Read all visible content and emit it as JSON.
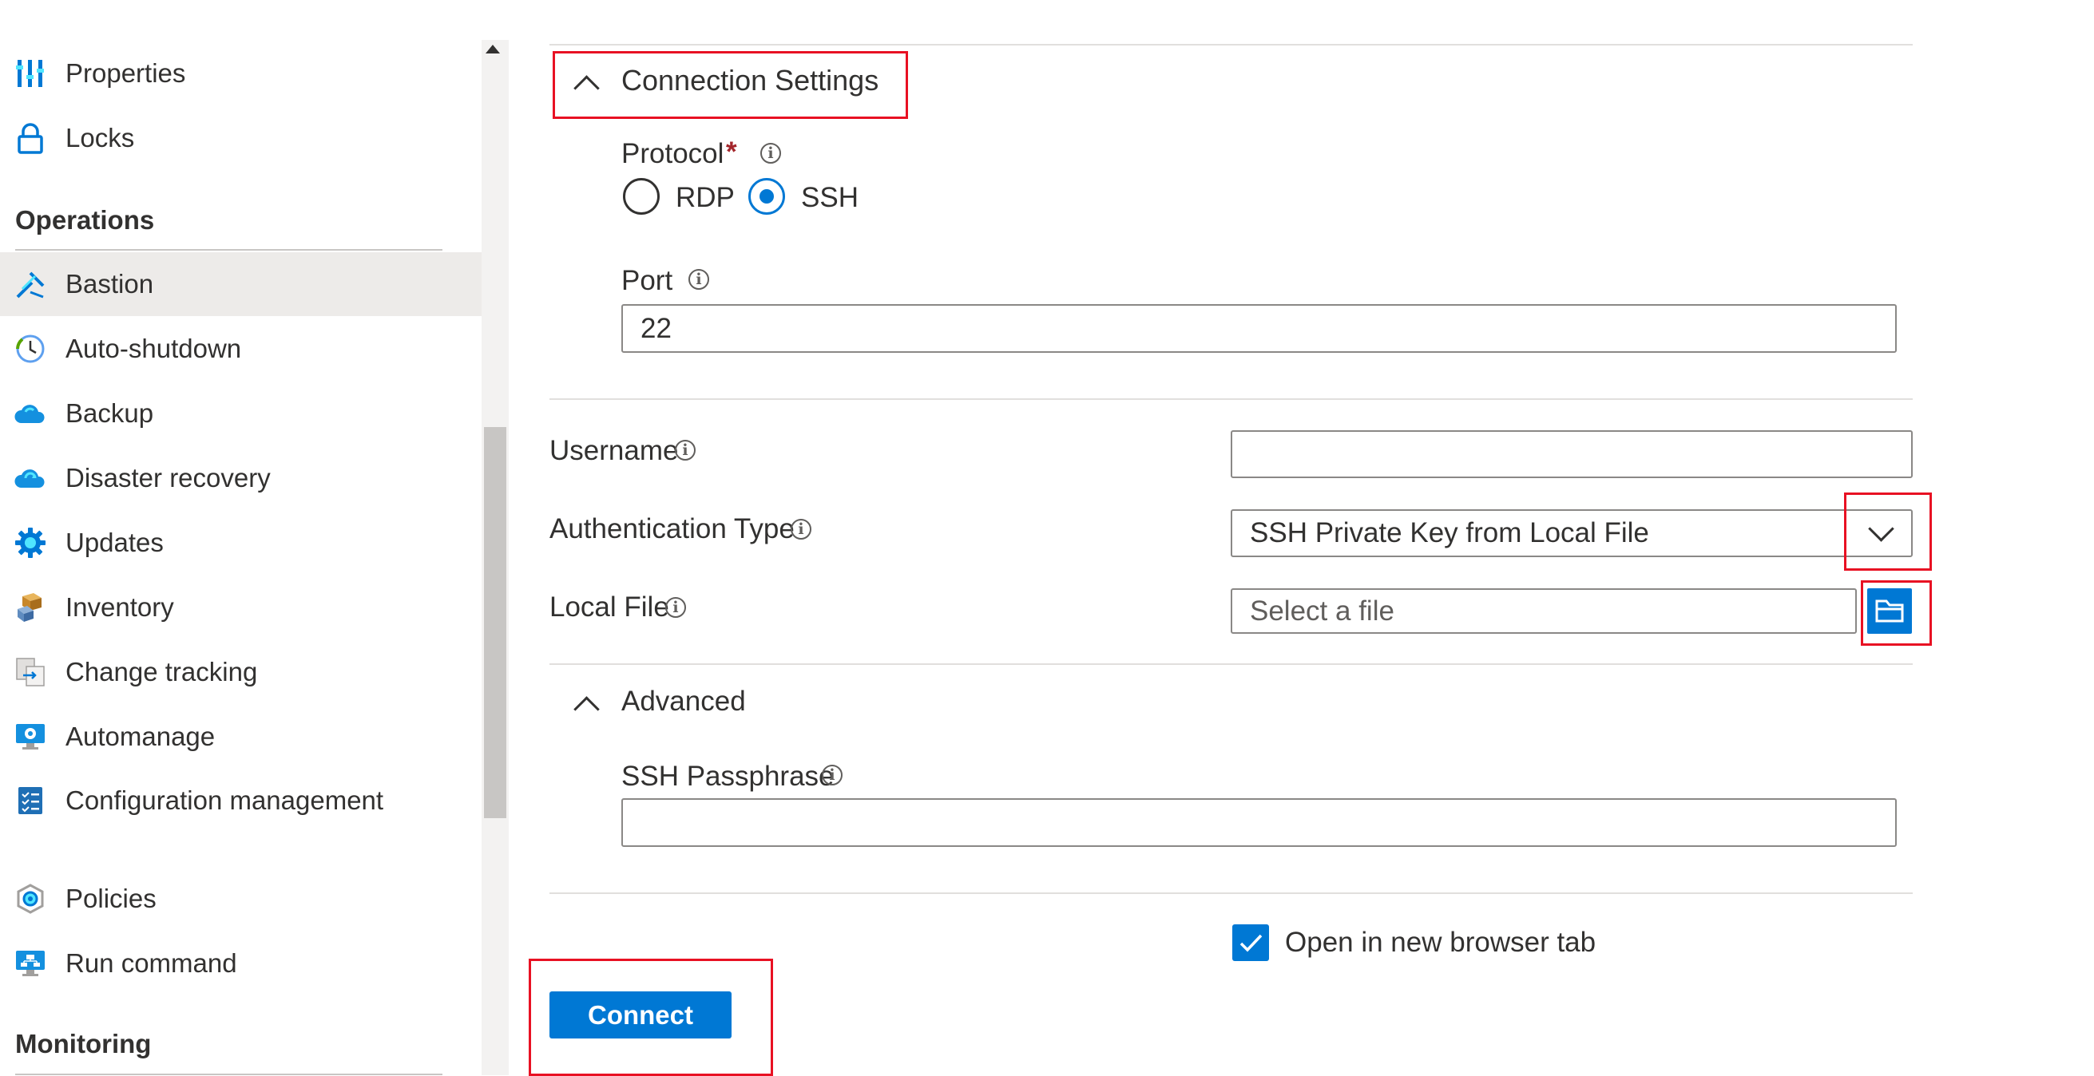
{
  "sidebar": {
    "top_items": [
      {
        "label": "Properties",
        "icon": "properties-icon"
      },
      {
        "label": "Locks",
        "icon": "lock-icon"
      }
    ],
    "operations_header": "Operations",
    "operations_items": [
      {
        "label": "Bastion",
        "icon": "bastion-icon",
        "selected": true
      },
      {
        "label": "Auto-shutdown",
        "icon": "clock-icon"
      },
      {
        "label": "Backup",
        "icon": "cloud-backup-icon"
      },
      {
        "label": "Disaster recovery",
        "icon": "cloud-recovery-icon"
      },
      {
        "label": "Updates",
        "icon": "gear-icon"
      },
      {
        "label": "Inventory",
        "icon": "boxes-icon"
      },
      {
        "label": "Change tracking",
        "icon": "change-tracking-icon"
      },
      {
        "label": "Automanage",
        "icon": "monitor-gear-icon"
      },
      {
        "label": "Configuration management",
        "icon": "checklist-icon"
      },
      {
        "label": "Policies",
        "icon": "policy-icon"
      },
      {
        "label": "Run command",
        "icon": "run-command-icon"
      }
    ],
    "monitoring_header": "Monitoring"
  },
  "connection_settings": {
    "title": "Connection Settings",
    "protocol_label": "Protocol",
    "required_mark": "*",
    "protocol_options": [
      "RDP",
      "SSH"
    ],
    "protocol_selected": "SSH",
    "port_label": "Port",
    "port_value": "22"
  },
  "form": {
    "username_label": "Username",
    "username_value": "",
    "auth_type_label": "Authentication Type",
    "auth_type_value": "SSH Private Key from Local File",
    "local_file_label": "Local File",
    "local_file_placeholder": "Select a file"
  },
  "advanced": {
    "title": "Advanced",
    "passphrase_label": "SSH Passphrase",
    "passphrase_value": ""
  },
  "open_new_tab": {
    "label": "Open in new browser tab",
    "checked": true
  },
  "connect_button": "Connect",
  "colors": {
    "accent": "#0078d4",
    "highlight_box": "#e81123",
    "required": "#a4262c",
    "selected_nav": "#edebe9"
  }
}
